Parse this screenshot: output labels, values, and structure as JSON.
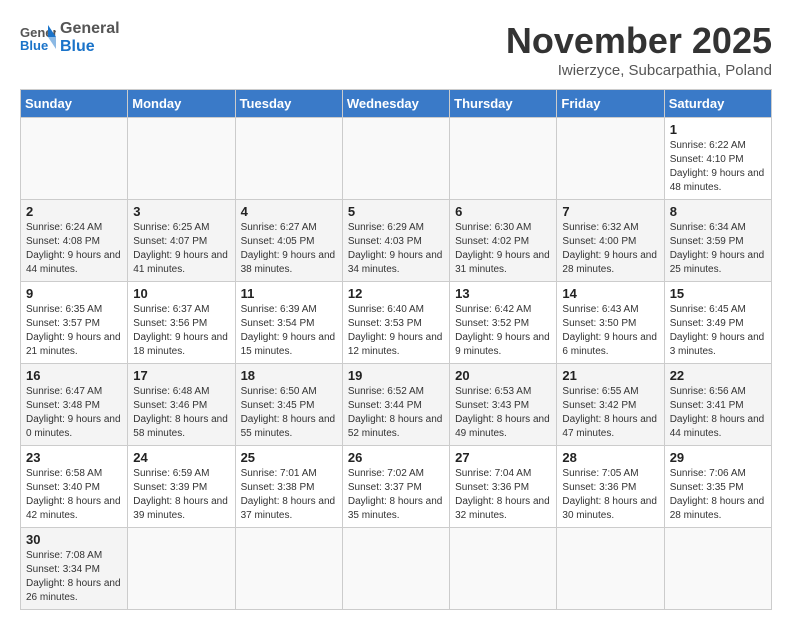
{
  "header": {
    "logo_general": "General",
    "logo_blue": "Blue",
    "month": "November 2025",
    "location": "Iwierzyce, Subcarpathia, Poland"
  },
  "days_of_week": [
    "Sunday",
    "Monday",
    "Tuesday",
    "Wednesday",
    "Thursday",
    "Friday",
    "Saturday"
  ],
  "weeks": [
    [
      {
        "day": "",
        "info": ""
      },
      {
        "day": "",
        "info": ""
      },
      {
        "day": "",
        "info": ""
      },
      {
        "day": "",
        "info": ""
      },
      {
        "day": "",
        "info": ""
      },
      {
        "day": "",
        "info": ""
      },
      {
        "day": "1",
        "info": "Sunrise: 6:22 AM\nSunset: 4:10 PM\nDaylight: 9 hours and 48 minutes."
      }
    ],
    [
      {
        "day": "2",
        "info": "Sunrise: 6:24 AM\nSunset: 4:08 PM\nDaylight: 9 hours and 44 minutes."
      },
      {
        "day": "3",
        "info": "Sunrise: 6:25 AM\nSunset: 4:07 PM\nDaylight: 9 hours and 41 minutes."
      },
      {
        "day": "4",
        "info": "Sunrise: 6:27 AM\nSunset: 4:05 PM\nDaylight: 9 hours and 38 minutes."
      },
      {
        "day": "5",
        "info": "Sunrise: 6:29 AM\nSunset: 4:03 PM\nDaylight: 9 hours and 34 minutes."
      },
      {
        "day": "6",
        "info": "Sunrise: 6:30 AM\nSunset: 4:02 PM\nDaylight: 9 hours and 31 minutes."
      },
      {
        "day": "7",
        "info": "Sunrise: 6:32 AM\nSunset: 4:00 PM\nDaylight: 9 hours and 28 minutes."
      },
      {
        "day": "8",
        "info": "Sunrise: 6:34 AM\nSunset: 3:59 PM\nDaylight: 9 hours and 25 minutes."
      }
    ],
    [
      {
        "day": "9",
        "info": "Sunrise: 6:35 AM\nSunset: 3:57 PM\nDaylight: 9 hours and 21 minutes."
      },
      {
        "day": "10",
        "info": "Sunrise: 6:37 AM\nSunset: 3:56 PM\nDaylight: 9 hours and 18 minutes."
      },
      {
        "day": "11",
        "info": "Sunrise: 6:39 AM\nSunset: 3:54 PM\nDaylight: 9 hours and 15 minutes."
      },
      {
        "day": "12",
        "info": "Sunrise: 6:40 AM\nSunset: 3:53 PM\nDaylight: 9 hours and 12 minutes."
      },
      {
        "day": "13",
        "info": "Sunrise: 6:42 AM\nSunset: 3:52 PM\nDaylight: 9 hours and 9 minutes."
      },
      {
        "day": "14",
        "info": "Sunrise: 6:43 AM\nSunset: 3:50 PM\nDaylight: 9 hours and 6 minutes."
      },
      {
        "day": "15",
        "info": "Sunrise: 6:45 AM\nSunset: 3:49 PM\nDaylight: 9 hours and 3 minutes."
      }
    ],
    [
      {
        "day": "16",
        "info": "Sunrise: 6:47 AM\nSunset: 3:48 PM\nDaylight: 9 hours and 0 minutes."
      },
      {
        "day": "17",
        "info": "Sunrise: 6:48 AM\nSunset: 3:46 PM\nDaylight: 8 hours and 58 minutes."
      },
      {
        "day": "18",
        "info": "Sunrise: 6:50 AM\nSunset: 3:45 PM\nDaylight: 8 hours and 55 minutes."
      },
      {
        "day": "19",
        "info": "Sunrise: 6:52 AM\nSunset: 3:44 PM\nDaylight: 8 hours and 52 minutes."
      },
      {
        "day": "20",
        "info": "Sunrise: 6:53 AM\nSunset: 3:43 PM\nDaylight: 8 hours and 49 minutes."
      },
      {
        "day": "21",
        "info": "Sunrise: 6:55 AM\nSunset: 3:42 PM\nDaylight: 8 hours and 47 minutes."
      },
      {
        "day": "22",
        "info": "Sunrise: 6:56 AM\nSunset: 3:41 PM\nDaylight: 8 hours and 44 minutes."
      }
    ],
    [
      {
        "day": "23",
        "info": "Sunrise: 6:58 AM\nSunset: 3:40 PM\nDaylight: 8 hours and 42 minutes."
      },
      {
        "day": "24",
        "info": "Sunrise: 6:59 AM\nSunset: 3:39 PM\nDaylight: 8 hours and 39 minutes."
      },
      {
        "day": "25",
        "info": "Sunrise: 7:01 AM\nSunset: 3:38 PM\nDaylight: 8 hours and 37 minutes."
      },
      {
        "day": "26",
        "info": "Sunrise: 7:02 AM\nSunset: 3:37 PM\nDaylight: 8 hours and 35 minutes."
      },
      {
        "day": "27",
        "info": "Sunrise: 7:04 AM\nSunset: 3:36 PM\nDaylight: 8 hours and 32 minutes."
      },
      {
        "day": "28",
        "info": "Sunrise: 7:05 AM\nSunset: 3:36 PM\nDaylight: 8 hours and 30 minutes."
      },
      {
        "day": "29",
        "info": "Sunrise: 7:06 AM\nSunset: 3:35 PM\nDaylight: 8 hours and 28 minutes."
      }
    ],
    [
      {
        "day": "30",
        "info": "Sunrise: 7:08 AM\nSunset: 3:34 PM\nDaylight: 8 hours and 26 minutes."
      },
      {
        "day": "",
        "info": ""
      },
      {
        "day": "",
        "info": ""
      },
      {
        "day": "",
        "info": ""
      },
      {
        "day": "",
        "info": ""
      },
      {
        "day": "",
        "info": ""
      },
      {
        "day": "",
        "info": ""
      }
    ]
  ]
}
